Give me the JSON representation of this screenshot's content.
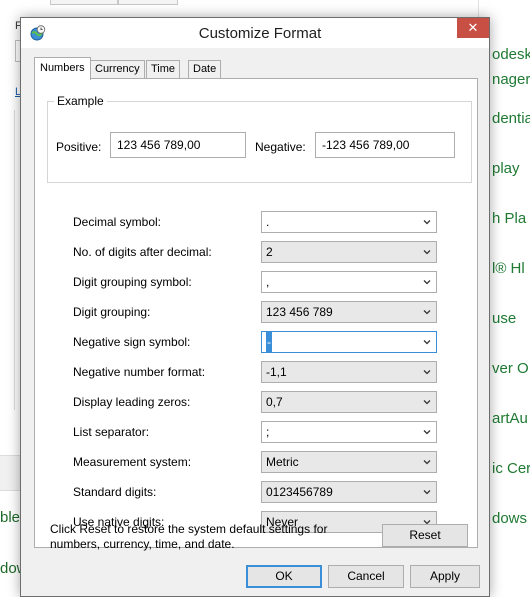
{
  "background": {
    "left_letters": [
      "F",
      "L"
    ],
    "left_bottom": [
      "ble",
      "dow"
    ],
    "right_items": [
      "odesk",
      "nager",
      "dentia",
      "play",
      "h Pla",
      "l® Hl",
      "use",
      "ver O",
      "artAu",
      "ic Cer",
      "dows"
    ]
  },
  "dialog": {
    "title": "Customize Format",
    "close_symbol": "✕",
    "tabs": [
      "Numbers",
      "Currency",
      "Time",
      "Date"
    ],
    "active_tab": "Numbers",
    "example": {
      "legend": "Example",
      "positive_label": "Positive:",
      "positive_value": "123 456 789,00",
      "negative_label": "Negative:",
      "negative_value": "-123 456 789,00"
    },
    "settings": [
      {
        "label": "Decimal symbol:",
        "value": ".",
        "style": "white"
      },
      {
        "label": "No. of digits after decimal:",
        "value": "2",
        "style": "grey"
      },
      {
        "label": "Digit grouping symbol:",
        "value": ",",
        "style": "white"
      },
      {
        "label": "Digit grouping:",
        "value": "123 456 789",
        "style": "grey"
      },
      {
        "label": "Negative sign symbol:",
        "value": "-",
        "style": "focused"
      },
      {
        "label": "Negative number format:",
        "value": "-1,1",
        "style": "grey"
      },
      {
        "label": "Display leading zeros:",
        "value": "0,7",
        "style": "grey"
      },
      {
        "label": "List separator:",
        "value": ";",
        "style": "white"
      },
      {
        "label": "Measurement system:",
        "value": "Metric",
        "style": "grey"
      },
      {
        "label": "Standard digits:",
        "value": "0123456789",
        "style": "grey"
      },
      {
        "label": "Use native digits:",
        "value": "Never",
        "style": "grey"
      }
    ],
    "reset_note": "Click Reset to restore the system default settings for numbers, currency, time, and date.",
    "reset_label": "Reset",
    "buttons": {
      "ok": "OK",
      "cancel": "Cancel",
      "apply": "Apply"
    }
  }
}
